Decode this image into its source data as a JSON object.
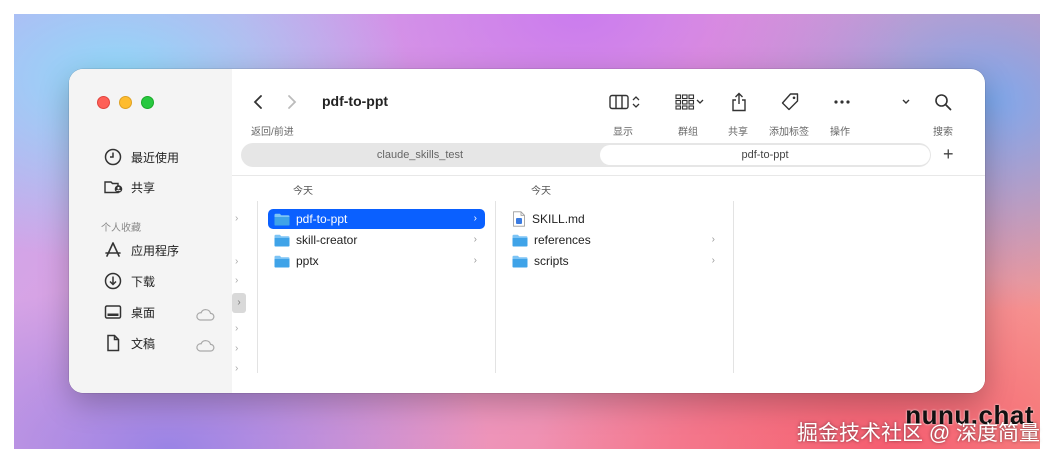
{
  "window": {
    "title": "pdf-to-ppt"
  },
  "toolbar": {
    "back_forward_label": "返回/前进",
    "display_label": "显示",
    "group_label": "群组",
    "share_label": "共享",
    "tag_label": "添加标签",
    "action_label": "操作",
    "search_label": "搜索"
  },
  "tabs": [
    {
      "label": "claude_skills_test",
      "active": false
    },
    {
      "label": "pdf-to-ppt",
      "active": true
    }
  ],
  "sidebar": {
    "items_top": [
      {
        "label": "最近使用",
        "icon": "clock-icon"
      },
      {
        "label": "共享",
        "icon": "shared-folder-icon"
      }
    ],
    "section_title": "个人收藏",
    "items_fav": [
      {
        "label": "应用程序",
        "icon": "applications-icon"
      },
      {
        "label": "下载",
        "icon": "download-icon"
      },
      {
        "label": "桌面",
        "icon": "desktop-icon"
      },
      {
        "label": "文稿",
        "icon": "document-icon"
      }
    ]
  },
  "columns": [
    {
      "header": "今天",
      "items": [
        {
          "name": "pdf-to-ppt",
          "type": "folder",
          "selected": true
        },
        {
          "name": "skill-creator",
          "type": "folder",
          "selected": false
        },
        {
          "name": "pptx",
          "type": "folder",
          "selected": false
        }
      ]
    },
    {
      "header": "今天",
      "items": [
        {
          "name": "SKILL.md",
          "type": "file"
        },
        {
          "name": "references",
          "type": "folder"
        },
        {
          "name": "scripts",
          "type": "folder"
        }
      ]
    }
  ],
  "watermark": {
    "brand": "nunu.chat",
    "sub": "掘金技术社区 @ 深度简量"
  },
  "colors": {
    "selection": "#0a60ff",
    "folder": "#3fa3e8"
  }
}
